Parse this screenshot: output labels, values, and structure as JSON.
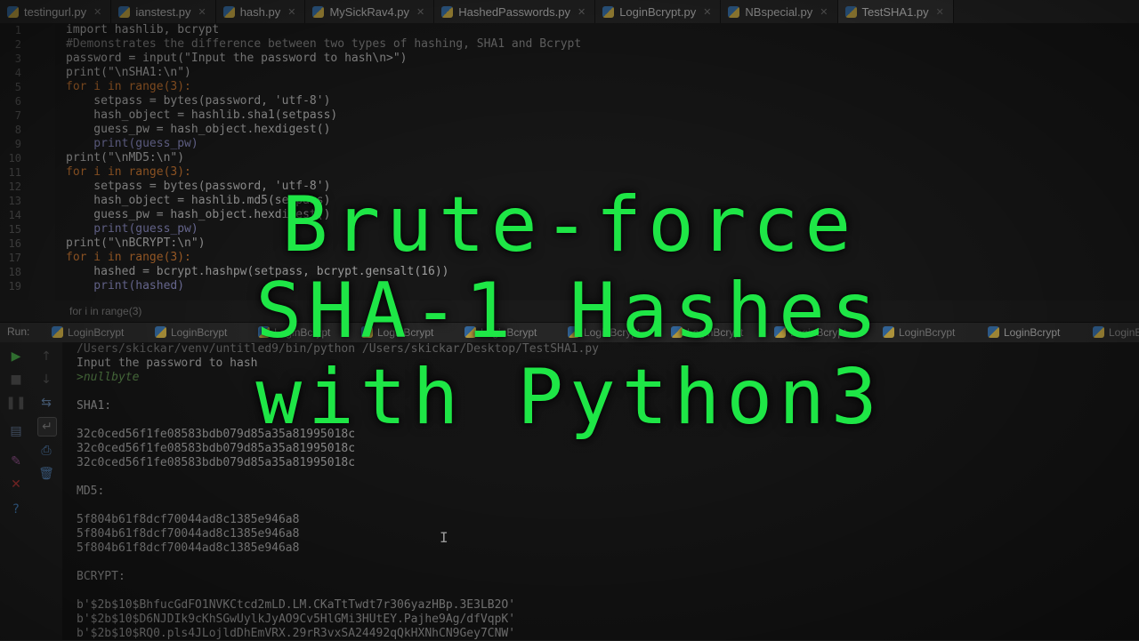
{
  "tabs": [
    {
      "label": "testingurl.py",
      "active": false
    },
    {
      "label": "ianstest.py",
      "active": false
    },
    {
      "label": "hash.py",
      "active": false
    },
    {
      "label": "MySickRav4.py",
      "active": false
    },
    {
      "label": "HashedPasswords.py",
      "active": false
    },
    {
      "label": "LoginBcrypt.py",
      "active": false
    },
    {
      "label": "NBspecial.py",
      "active": false
    },
    {
      "label": "TestSHA1.py",
      "active": true
    }
  ],
  "editor": {
    "lines": [
      {
        "num": "1",
        "code": "import hashlib, bcrypt"
      },
      {
        "num": "2",
        "code": "#Demonstrates the difference between two types of hashing, SHA1 and Bcrypt"
      },
      {
        "num": "3",
        "code": "password = input(\"Input the password to hash\\n>\")"
      },
      {
        "num": "4",
        "code": "print(\"\\nSHA1:\\n\")"
      },
      {
        "num": "5",
        "code": "for i in range(3):"
      },
      {
        "num": "6",
        "code": "    setpass = bytes(password, 'utf-8')"
      },
      {
        "num": "7",
        "code": "    hash_object = hashlib.sha1(setpass)"
      },
      {
        "num": "8",
        "code": "    guess_pw = hash_object.hexdigest()"
      },
      {
        "num": "9",
        "code": "    print(guess_pw)"
      },
      {
        "num": "10",
        "code": "print(\"\\nMD5:\\n\")"
      },
      {
        "num": "11",
        "code": "for i in range(3):"
      },
      {
        "num": "12",
        "code": "    setpass = bytes(password, 'utf-8')"
      },
      {
        "num": "13",
        "code": "    hash_object = hashlib.md5(setpass)"
      },
      {
        "num": "14",
        "code": "    guess_pw = hash_object.hexdigest()"
      },
      {
        "num": "15",
        "code": "    print(guess_pw)"
      },
      {
        "num": "16",
        "code": "print(\"\\nBCRYPT:\\n\")"
      },
      {
        "num": "17",
        "code": "for i in range(3):"
      },
      {
        "num": "18",
        "code": "    hashed = bcrypt.hashpw(setpass, bcrypt.gensalt(16))"
      },
      {
        "num": "19",
        "code": "    print(hashed)"
      }
    ],
    "breadcrumb": "for i in range(3)"
  },
  "run": {
    "label": "Run:",
    "tabs": [
      "LoginBcrypt",
      "LoginBcrypt",
      "LoginBcrypt",
      "LoginBcrypt",
      "LoginBcrypt",
      "LoginBcrypt",
      "LoginBcrypt",
      "LoginBcrypt",
      "LoginBcrypt",
      "LoginBcrypt",
      "LoginBcrypt"
    ]
  },
  "console": {
    "command": "/Users/skickar/venv/untitled9/bin/python /Users/skickar/Desktop/TestSHA1.py",
    "prompt": "Input the password to hash",
    "input": ">nullbyte",
    "sha1_label": "SHA1:",
    "sha1": [
      "32c0ced56f1fe08583bdb079d85a35a81995018c",
      "32c0ced56f1fe08583bdb079d85a35a81995018c",
      "32c0ced56f1fe08583bdb079d85a35a81995018c"
    ],
    "md5_label": "MD5:",
    "md5": [
      "5f804b61f8dcf70044ad8c1385e946a8",
      "5f804b61f8dcf70044ad8c1385e946a8",
      "5f804b61f8dcf70044ad8c1385e946a8"
    ],
    "bcrypt_label": "BCRYPT:",
    "bcrypt": [
      "b'$2b$10$BhfucGdFO1NVKCtcd2mLD.LM.CKaTtTwdt7r306yazHBp.3E3LB2O'",
      "b'$2b$10$D6NJDIk9cKhSGwUylkJyAO9Cv5HlGMi3HUtEY.Pajhe9Ag/dfVqpK'",
      "b'$2b$10$RQ0.pls4JLojldDhEmVRX.29rR3vxSA24492qQkHXNhCN9Gey7CNW'"
    ]
  },
  "overlay": {
    "line1": "Brute-force",
    "line2": "SHA-1 Hashes",
    "line3": "with Python3",
    "color": "#1ee646"
  },
  "icons": {
    "run": "play-icon",
    "stop": "stop-icon",
    "pause": "pause-icon",
    "rerun": "rerun-icon",
    "layout": "layout-icon",
    "print": "print-icon",
    "trash": "trash-icon",
    "pin": "pin-icon",
    "close": "close-icon",
    "help": "help-icon"
  }
}
